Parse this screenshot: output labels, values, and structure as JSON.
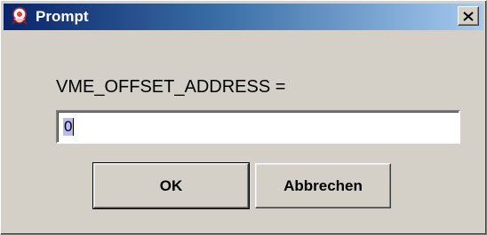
{
  "window": {
    "title": "Prompt",
    "close_symbol": "✕"
  },
  "prompt": {
    "label": "VME_OFFSET_ADDRESS =",
    "value": "0"
  },
  "buttons": {
    "ok_label": "OK",
    "cancel_label": "Abbrechen"
  },
  "icons": {
    "app": "java-duke-icon",
    "close": "close-icon"
  },
  "colors": {
    "title_gradient_start": "#0a246a",
    "title_gradient_end": "#a6caf0",
    "selection": "#b8bcf0",
    "dialog_bg": "#d4d0c8"
  }
}
